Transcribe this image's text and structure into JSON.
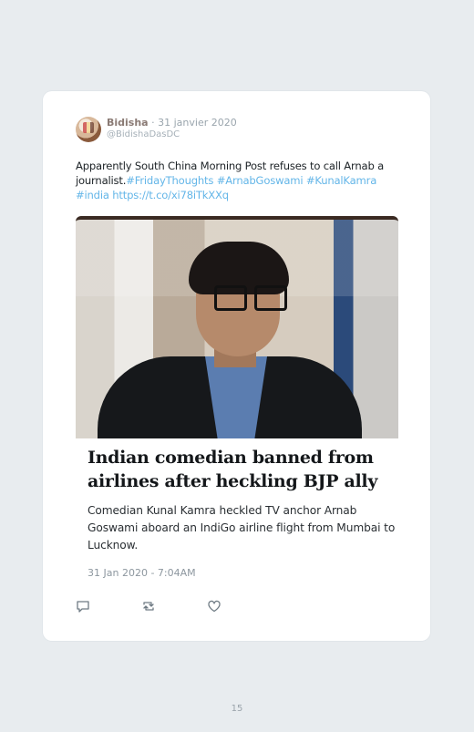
{
  "tweet": {
    "author_name": "Bidisha",
    "separator": " · ",
    "date": "31 janvier 2020",
    "handle": "@BidishaDasDC",
    "text_plain": "Apparently South China Morning Post refuses to call Arnab a journalist.",
    "links": [
      "#FridayThoughts",
      "#ArnabGoswami",
      "#KunalKamra",
      "#india",
      "https://t.co/xi78iTkXXq"
    ]
  },
  "article": {
    "title": "Indian comedian banned from airlines after heckling BJP ally",
    "description": "Comedian Kunal Kamra heckled TV anchor Arnab Goswami aboard an IndiGo airline flight from Mumbai to Lucknow.",
    "date": "31 Jan 2020 - 7:04AM"
  },
  "actions": [
    {
      "name": "reply-icon"
    },
    {
      "name": "retweet-icon"
    },
    {
      "name": "like-icon"
    }
  ],
  "page": {
    "number": "15"
  },
  "colors": {
    "link": "#64b6e8",
    "background": "#e8ecef",
    "card": "#ffffff"
  }
}
